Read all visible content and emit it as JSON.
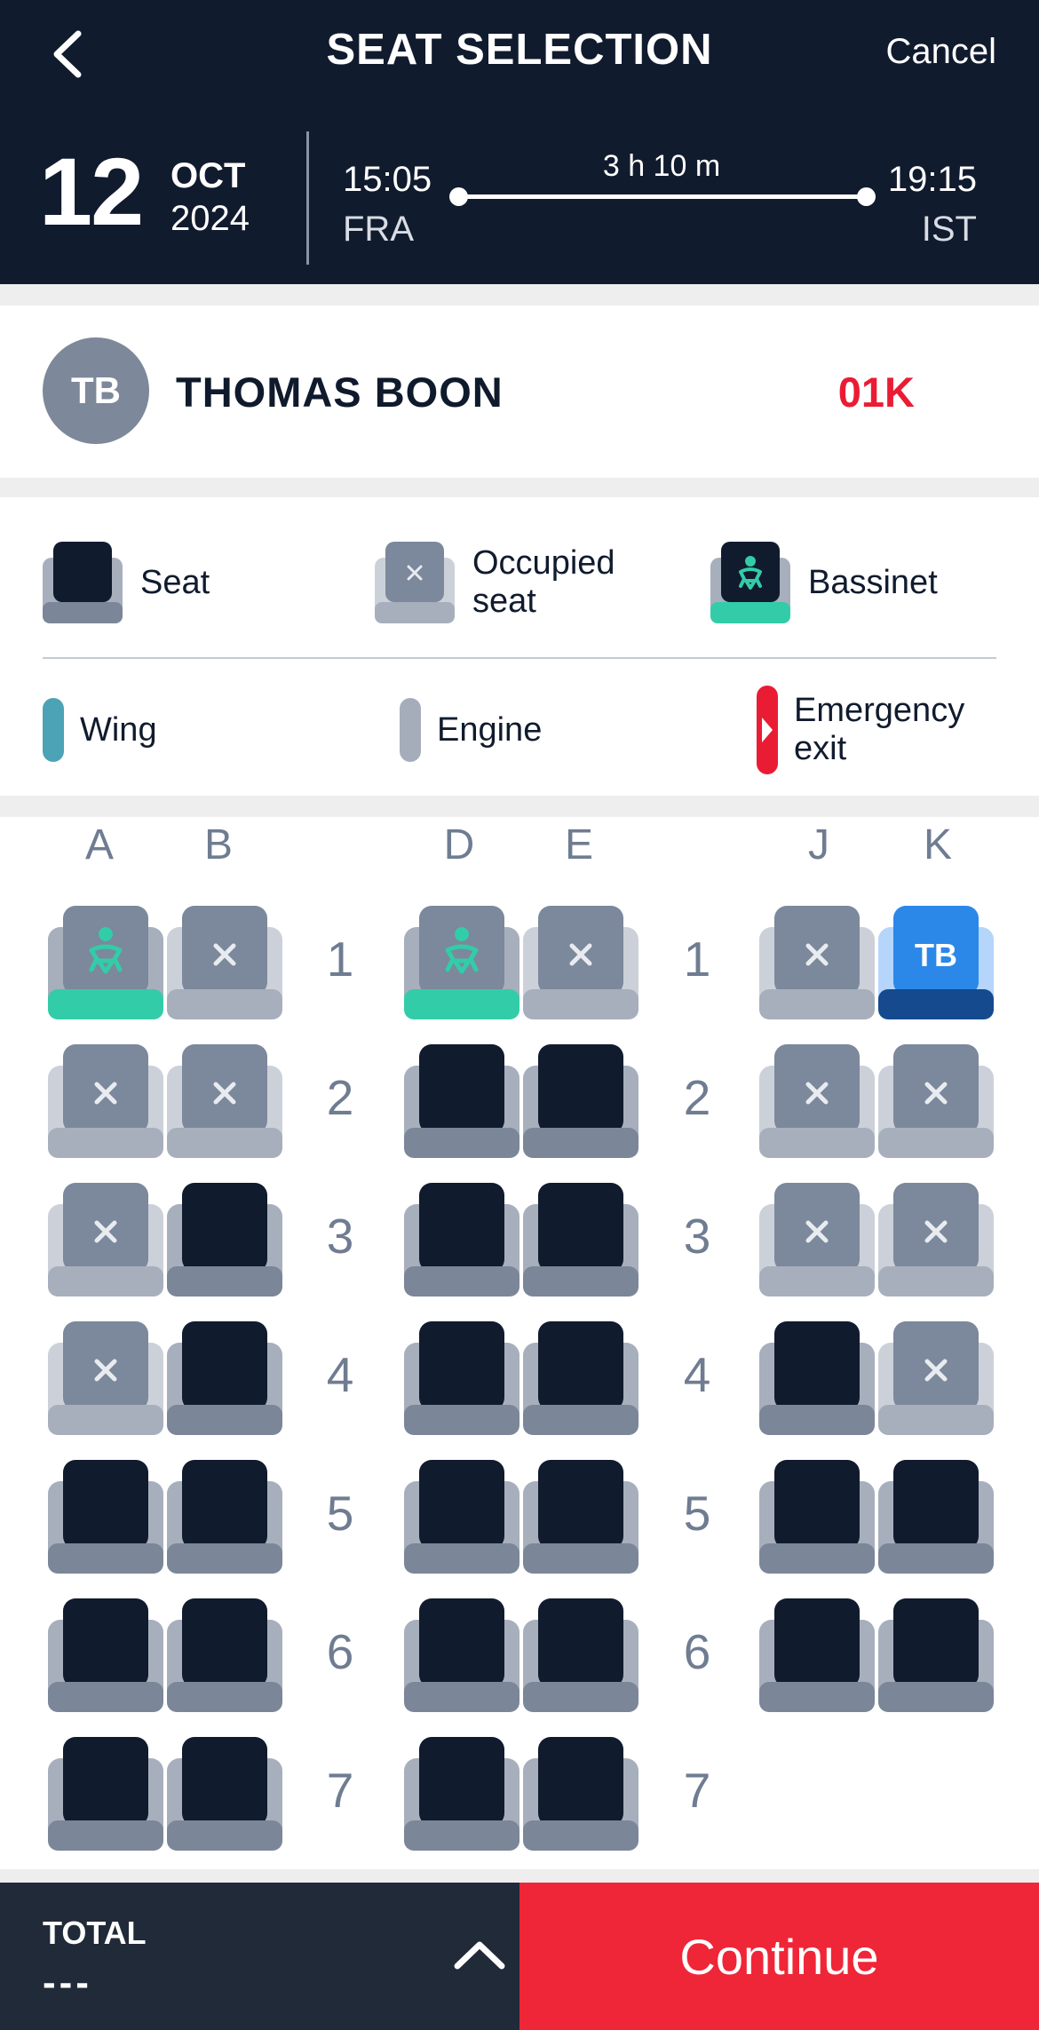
{
  "header": {
    "title": "SEAT SELECTION",
    "cancel_label": "Cancel",
    "date": {
      "day": "12",
      "month": "OCT",
      "year": "2024"
    },
    "departure": {
      "time": "15:05",
      "code": "FRA"
    },
    "arrival": {
      "time": "19:15",
      "code": "IST"
    },
    "duration": "3 h 10 m"
  },
  "passenger": {
    "initials": "TB",
    "name": "THOMAS BOON",
    "seat": "01K"
  },
  "legend": {
    "seat": "Seat",
    "occupied_line1": "Occupied",
    "occupied_line2": "seat",
    "bassinet": "Bassinet",
    "wing": "Wing",
    "engine": "Engine",
    "exit_line1": "Emergency",
    "exit_line2": "exit"
  },
  "seatmap": {
    "columns": [
      "A",
      "B",
      "D",
      "E",
      "J",
      "K"
    ],
    "rows": [
      {
        "number": "1",
        "seats": [
          "bassinet",
          "occupied",
          "bassinet",
          "occupied",
          "occupied",
          "selected"
        ]
      },
      {
        "number": "2",
        "seats": [
          "occupied",
          "occupied",
          "available",
          "available",
          "occupied",
          "occupied"
        ]
      },
      {
        "number": "3",
        "seats": [
          "occupied",
          "available",
          "available",
          "available",
          "occupied",
          "occupied"
        ]
      },
      {
        "number": "4",
        "seats": [
          "occupied",
          "available",
          "available",
          "available",
          "available",
          "occupied"
        ]
      },
      {
        "number": "5",
        "seats": [
          "available",
          "available",
          "available",
          "available",
          "available",
          "available"
        ]
      },
      {
        "number": "6",
        "seats": [
          "available",
          "available",
          "available",
          "available",
          "available",
          "available"
        ]
      },
      {
        "number": "7",
        "seats": [
          "available",
          "available",
          "available",
          "available",
          "none",
          "none"
        ]
      }
    ],
    "selected_label": "TB"
  },
  "colors": {
    "navy": "#111b2e",
    "seat_frame": "#a7afbd",
    "seat_base": "#7b8699",
    "occupied_back": "#7c889b",
    "occupied_frame": "#ccd1d9",
    "bassinet_green": "#33cca8",
    "selected_blue": "#2b88e8",
    "selected_dark": "#154a8f",
    "wing": "#4da3b6",
    "engine": "#a6adba",
    "exit_red": "#ea1c34",
    "accent_red": "#ef2637"
  },
  "footer": {
    "total_label": "TOTAL",
    "total_value": "---",
    "continue_label": "Continue"
  }
}
